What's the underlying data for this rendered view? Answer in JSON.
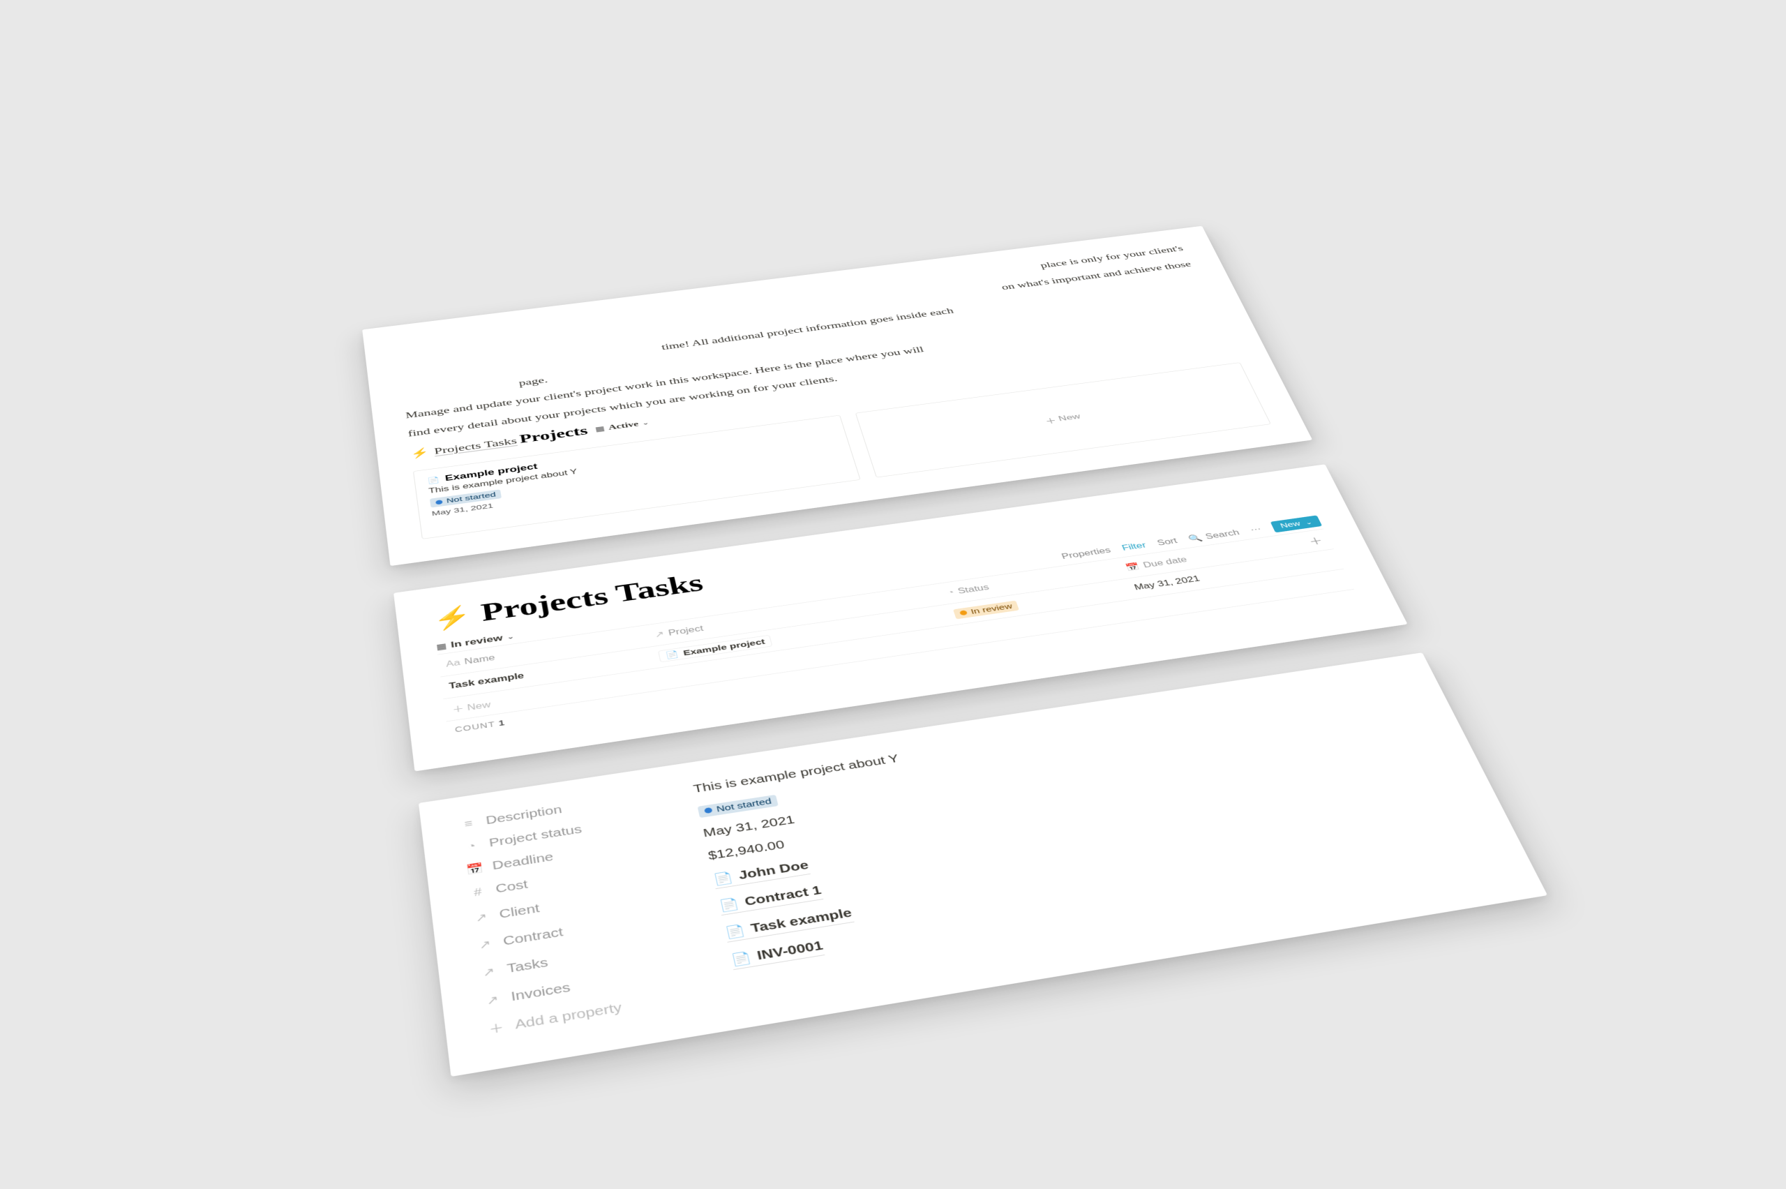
{
  "intro": {
    "line1_tail": "place is only for your client's",
    "line2_tail": "on what's important and achieve those",
    "line3_prefix": "time! All additional project information goes inside each",
    "line4_suffix": "page.",
    "workspace_line_a": "Manage and update your client's project work in this workspace. Here is the place where you will",
    "workspace_line_b": "find every detail about your projects which you are working on for your clients.",
    "link_label": "Projects Tasks"
  },
  "projects": {
    "heading": "Projects",
    "view_name": "Active",
    "card": {
      "title": "Example project",
      "description": "This is example project about Y",
      "status": "Not started",
      "date": "May 31, 2021"
    },
    "new_label": "New"
  },
  "tasks": {
    "heading": "Projects Tasks",
    "view_name": "In review",
    "toolbar": {
      "properties": "Properties",
      "filter": "Filter",
      "sort": "Sort",
      "search": "Search",
      "more": "···",
      "new": "New"
    },
    "columns": {
      "name": "Name",
      "project": "Project",
      "status": "Status",
      "due": "Due date"
    },
    "row": {
      "name": "Task example",
      "project": "Example project",
      "status": "In review",
      "due": "May 31, 2021"
    },
    "new_row": "New",
    "count_label": "COUNT",
    "count_value": "1"
  },
  "details": {
    "labels": {
      "description": "Description",
      "project_status": "Project status",
      "deadline": "Deadline",
      "cost": "Cost",
      "client": "Client",
      "contract": "Contract",
      "tasks": "Tasks",
      "invoices": "Invoices",
      "add_property": "Add a property"
    },
    "values": {
      "description": "This is example project about Y",
      "project_status": "Not started",
      "deadline": "May 31, 2021",
      "cost": "$12,940.00",
      "client": "John Doe",
      "contract": "Contract 1",
      "tasks": "Task example",
      "invoices": "INV-0001"
    }
  }
}
